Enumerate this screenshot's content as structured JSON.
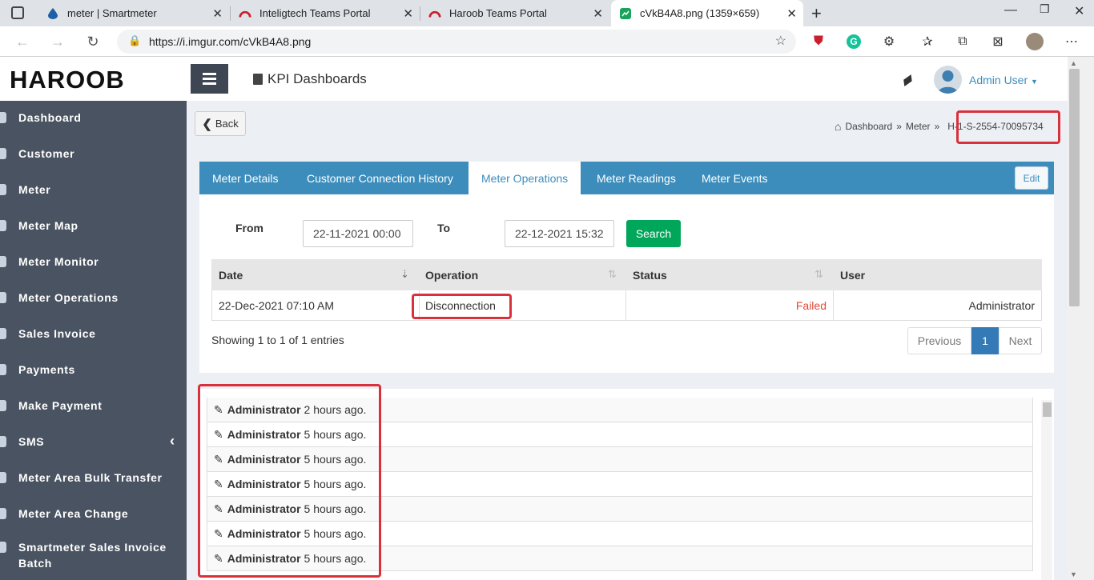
{
  "browser": {
    "tabs": [
      {
        "title": "meter | Smartmeter"
      },
      {
        "title": "Inteligtech Teams Portal"
      },
      {
        "title": "Haroob Teams Portal"
      },
      {
        "title": "cVkB4A8.png (1359×659)"
      }
    ],
    "url": "https://i.imgur.com/cVkB4A8.png"
  },
  "header": {
    "logo": "HAROOB",
    "page_title": "KPI Dashboards",
    "user": "Admin User"
  },
  "sidebar": {
    "items": [
      {
        "label": "Dashboard"
      },
      {
        "label": "Customer"
      },
      {
        "label": "Meter"
      },
      {
        "label": "Meter Map"
      },
      {
        "label": "Meter Monitor"
      },
      {
        "label": "Meter Operations"
      },
      {
        "label": "Sales Invoice"
      },
      {
        "label": "Payments"
      },
      {
        "label": "Make Payment"
      },
      {
        "label": "SMS"
      },
      {
        "label": "Meter Area Bulk Transfer"
      },
      {
        "label": "Meter Area Change"
      },
      {
        "label": "Smartmeter Sales Invoice Batch"
      }
    ],
    "chevron": "‹"
  },
  "content": {
    "back_label": "Back",
    "breadcrumb": {
      "home": "Dashboard",
      "sep": "»",
      "section": "Meter",
      "current": "H-1-S-2554-70095734"
    },
    "tabs": [
      {
        "label": "Meter Details"
      },
      {
        "label": "Customer Connection History"
      },
      {
        "label": "Meter Operations"
      },
      {
        "label": "Meter Readings"
      },
      {
        "label": "Meter Events"
      }
    ],
    "edit_label": "Edit",
    "filter": {
      "from_label": "From",
      "from_value": "22-11-2021 00:00",
      "to_label": "To",
      "to_value": "22-12-2021 15:32",
      "search_label": "Search"
    },
    "table": {
      "columns": [
        "Date",
        "Operation",
        "Status",
        "User"
      ],
      "rows": [
        {
          "date": "22-Dec-2021 07:10 AM",
          "operation": "Disconnection",
          "status": "Failed",
          "user": "Administrator"
        }
      ]
    },
    "showing": "Showing 1 to 1 of 1 entries",
    "pagination": {
      "previous": "Previous",
      "page": "1",
      "next": "Next"
    },
    "activity": [
      {
        "user": "Administrator",
        "time": "2 hours ago."
      },
      {
        "user": "Administrator",
        "time": "5 hours ago."
      },
      {
        "user": "Administrator",
        "time": "5 hours ago."
      },
      {
        "user": "Administrator",
        "time": "5 hours ago."
      },
      {
        "user": "Administrator",
        "time": "5 hours ago."
      },
      {
        "user": "Administrator",
        "time": "5 hours ago."
      },
      {
        "user": "Administrator",
        "time": "5 hours ago."
      }
    ]
  },
  "colors": {
    "sidebar": "#4a5361",
    "accent": "#3c8dbc",
    "success": "#00a65a",
    "danger": "#d9313c"
  }
}
